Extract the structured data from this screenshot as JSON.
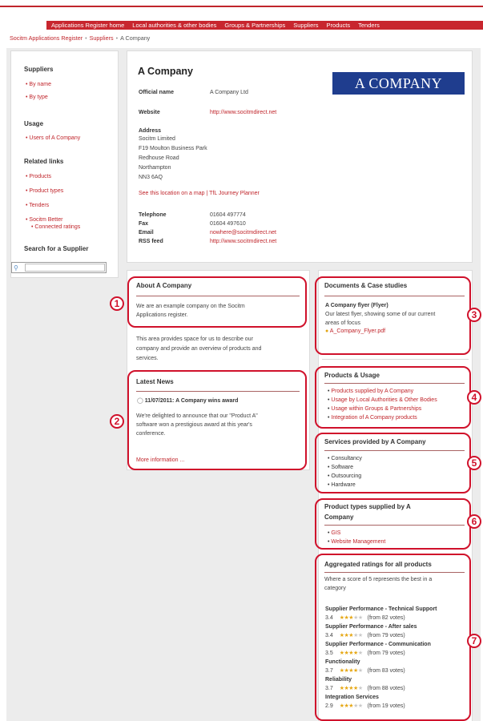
{
  "nav": [
    "Applications Register home",
    "Local authorities & other bodies",
    "Groups & Partnerships",
    "Suppliers",
    "Products",
    "Tenders"
  ],
  "breadcrumb": [
    "Socitm Applications Register",
    "Suppliers",
    "A Company"
  ],
  "sidebar": {
    "suppliers_heading": "Suppliers",
    "suppliers_items": [
      "By name",
      "By type"
    ],
    "usage_heading": "Usage",
    "usage_items": [
      "Users of A Company"
    ],
    "related_heading": "Related links",
    "related_items": [
      "Products",
      "Product types",
      "Tenders",
      "Socitm Better",
      "Connected ratings"
    ],
    "search_heading": "Search for a Supplier",
    "search_value": ""
  },
  "company": {
    "title": "A Company",
    "logo_text": "A COMPANY",
    "official_name_label": "Official name",
    "official_name": "A Company Ltd",
    "website_label": "Website",
    "website": "http://www.socitmdirect.net",
    "address_label": "Address",
    "address": [
      "Socitm Limited",
      "F19 Moulton Business Park",
      "Redhouse Road",
      "Northampton",
      "NN3 6AQ"
    ],
    "map_link": "See this location on a map",
    "map_sep": " | ",
    "journey_link": "TfL Journey Planner",
    "telephone_label": "Telephone",
    "telephone": "01604 497774",
    "fax_label": "Fax",
    "fax": "01604 497610",
    "email_label": "Email",
    "email": "nowhere@socitmdirect.net",
    "rss_label": "RSS feed",
    "rss": "http://www.socitmdirect.net"
  },
  "about": {
    "title": "About A Company",
    "line1": "We are an example company on the Socitm",
    "line2": "Applications register.",
    "extra1": "This area provides space for us to describe our",
    "extra2": "company and provide an overview of products and",
    "extra3": "services."
  },
  "news": {
    "title": "Latest News",
    "headline": "11/07/2011: A Company wins award",
    "body1": "We're delighted to announce that our \"Product A\"",
    "body2": "software won a prestigious award at this year's",
    "body3": "conference.",
    "more": "More information ..."
  },
  "documents": {
    "title": "Documents & Case studies",
    "doc_title": "A Company flyer (Flyer)",
    "desc1": "Our latest flyer, showing some of our current",
    "desc2": "areas of focus",
    "file": "A_Company_Flyer.pdf"
  },
  "products_usage": {
    "title": "Products & Usage",
    "items": [
      "Products supplied by A Company",
      "Usage by Local Authorities & Other Bodies",
      "Usage within Groups & Partnerships",
      "Integration of A Company products"
    ]
  },
  "services": {
    "title": "Services provided by A Company",
    "items": [
      "Consultancy",
      "Software",
      "Outsourcing",
      "Hardware"
    ]
  },
  "product_types": {
    "title1": "Product types supplied by A",
    "title2": "Company",
    "items": [
      "GIS",
      "Website Management"
    ]
  },
  "ratings": {
    "title": "Aggregated ratings for all products",
    "note1": "Where a score of 5 represents the best in a",
    "note2": "category",
    "items": [
      {
        "name": "Supplier Performance - Technical Support",
        "score": "3.4",
        "votes": "(from 82 votes)"
      },
      {
        "name": "Supplier Performance - After sales",
        "score": "3.4",
        "votes": "(from 79 votes)"
      },
      {
        "name": "Supplier Performance - Communication",
        "score": "3.5",
        "votes": "(from 79 votes)"
      },
      {
        "name": "Functionality",
        "score": "3.7",
        "votes": "(from 83 votes)"
      },
      {
        "name": "Reliability",
        "score": "3.7",
        "votes": "(from 88 votes)"
      },
      {
        "name": "Integration Services",
        "score": "2.9",
        "votes": "(from 19 votes)"
      }
    ]
  },
  "callouts": [
    "1",
    "2",
    "3",
    "4",
    "5",
    "6",
    "7"
  ],
  "colors": {
    "brand_red": "#c8262e",
    "callout_red": "#d0112b",
    "logo_blue": "#1f3d8e",
    "star": "#e6a817"
  }
}
